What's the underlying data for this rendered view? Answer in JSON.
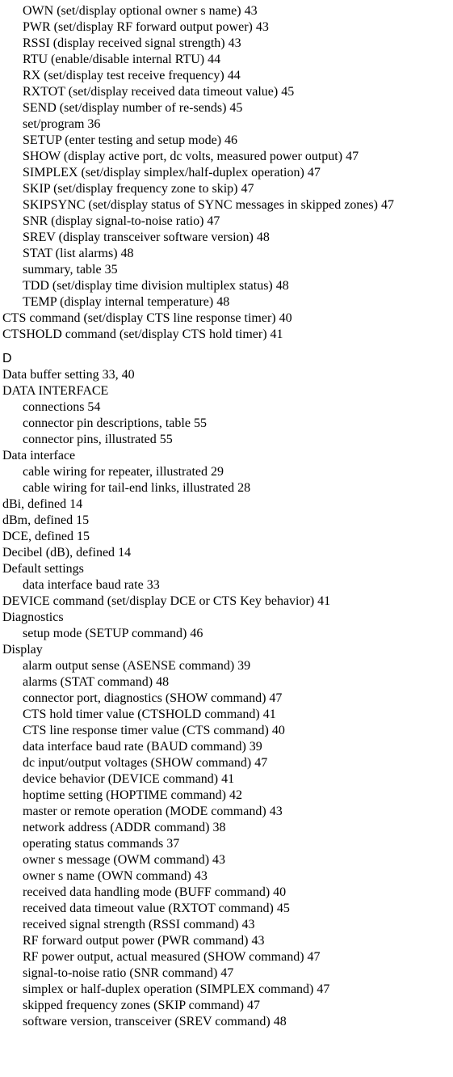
{
  "entries": [
    {
      "level": 1,
      "text": "OWN (set/display optional owner s name)",
      "pages": "43"
    },
    {
      "level": 1,
      "text": "PWR (set/display RF forward output power)",
      "pages": "43"
    },
    {
      "level": 1,
      "text": "RSSI (display received signal strength)",
      "pages": "43"
    },
    {
      "level": 1,
      "text": "RTU (enable/disable internal RTU)",
      "pages": "44"
    },
    {
      "level": 1,
      "text": "RX (set/display test receive frequency)",
      "pages": "44"
    },
    {
      "level": 1,
      "text": "RXTOT (set/display received data timeout value)",
      "pages": "45"
    },
    {
      "level": 1,
      "text": "SEND (set/display number of re-sends)",
      "pages": "45"
    },
    {
      "level": 1,
      "text": "set/program",
      "pages": "36"
    },
    {
      "level": 1,
      "text": "SETUP (enter testing and setup mode)",
      "pages": "46"
    },
    {
      "level": 1,
      "text": "SHOW (display active port, dc volts, measured power output)",
      "pages": "47"
    },
    {
      "level": 1,
      "text": "SIMPLEX (set/display simplex/half-duplex operation)",
      "pages": "47"
    },
    {
      "level": 1,
      "text": "SKIP (set/display frequency zone to skip)",
      "pages": "47"
    },
    {
      "level": 1,
      "text": "SKIPSYNC (set/display status of SYNC messages in skipped zones)",
      "pages": "47"
    },
    {
      "level": 1,
      "text": "SNR (display signal-to-noise ratio)",
      "pages": "47"
    },
    {
      "level": 1,
      "text": "SREV (display transceiver software version)",
      "pages": "48"
    },
    {
      "level": 1,
      "text": "STAT (list alarms)",
      "pages": "48"
    },
    {
      "level": 1,
      "text": "summary, table",
      "pages": "35"
    },
    {
      "level": 1,
      "text": "TDD (set/display time division multiplex status)",
      "pages": "48"
    },
    {
      "level": 1,
      "text": "TEMP (display internal temperature)",
      "pages": "48"
    },
    {
      "level": 0,
      "text": "CTS command (set/display CTS line response timer)",
      "pages": "40"
    },
    {
      "level": 0,
      "text": "CTSHOLD command (set/display CTS hold timer)",
      "pages": "41"
    },
    {
      "section": "D"
    },
    {
      "level": 0,
      "text": "Data buffer setting",
      "pages": "33, 40"
    },
    {
      "level": 0,
      "text": "DATA INTERFACE",
      "pages": ""
    },
    {
      "level": 1,
      "text": "connections",
      "pages": "54"
    },
    {
      "level": 1,
      "text": "connector pin descriptions, table",
      "pages": "55"
    },
    {
      "level": 1,
      "text": "connector pins, illustrated",
      "pages": "55"
    },
    {
      "level": 0,
      "text": "Data interface",
      "pages": ""
    },
    {
      "level": 1,
      "text": "cable wiring for repeater, illustrated",
      "pages": "29"
    },
    {
      "level": 1,
      "text": "cable wiring for tail-end links, illustrated",
      "pages": "28"
    },
    {
      "level": 0,
      "text": "dBi, defined",
      "pages": "14"
    },
    {
      "level": 0,
      "text": "dBm, defined",
      "pages": "15"
    },
    {
      "level": 0,
      "text": "DCE, defined",
      "pages": "15"
    },
    {
      "level": 0,
      "text": "Decibel (dB), defined",
      "pages": "14"
    },
    {
      "level": 0,
      "text": "Default settings",
      "pages": ""
    },
    {
      "level": 1,
      "text": "data interface baud rate",
      "pages": "33"
    },
    {
      "level": 0,
      "text": "DEVICE command (set/display DCE or CTS Key behavior)",
      "pages": "41"
    },
    {
      "level": 0,
      "text": "Diagnostics",
      "pages": ""
    },
    {
      "level": 1,
      "text": "setup mode (SETUP command)",
      "pages": "46"
    },
    {
      "level": 0,
      "text": "Display",
      "pages": ""
    },
    {
      "level": 1,
      "text": "alarm output sense (ASENSE command)",
      "pages": "39"
    },
    {
      "level": 1,
      "text": "alarms (STAT command)",
      "pages": "48"
    },
    {
      "level": 1,
      "text": "connector port, diagnostics (SHOW command)",
      "pages": "47"
    },
    {
      "level": 1,
      "text": "CTS hold timer value (CTSHOLD command)",
      "pages": "41"
    },
    {
      "level": 1,
      "text": "CTS line response timer value (CTS command)",
      "pages": "40"
    },
    {
      "level": 1,
      "text": "data interface baud rate (BAUD command)",
      "pages": "39"
    },
    {
      "level": 1,
      "text": "dc input/output voltages (SHOW command)",
      "pages": "47"
    },
    {
      "level": 1,
      "text": "device behavior (DEVICE command)",
      "pages": "41"
    },
    {
      "level": 1,
      "text": "hoptime setting (HOPTIME command)",
      "pages": "42"
    },
    {
      "level": 1,
      "text": "master or remote operation (MODE command)",
      "pages": "43"
    },
    {
      "level": 1,
      "text": "network address (ADDR command)",
      "pages": "38"
    },
    {
      "level": 1,
      "text": "operating status commands",
      "pages": "37"
    },
    {
      "level": 1,
      "text": "owner s message (OWM command)",
      "pages": "43"
    },
    {
      "level": 1,
      "text": "owner s name (OWN command)",
      "pages": "43"
    },
    {
      "level": 1,
      "text": "received data handling mode (BUFF command)",
      "pages": "40"
    },
    {
      "level": 1,
      "text": "received data timeout value (RXTOT command)",
      "pages": "45"
    },
    {
      "level": 1,
      "text": "received signal strength (RSSI command)",
      "pages": "43"
    },
    {
      "level": 1,
      "text": "RF forward output power (PWR command)",
      "pages": "43"
    },
    {
      "level": 1,
      "text": "RF power output, actual measured (SHOW command)",
      "pages": "47"
    },
    {
      "level": 1,
      "text": "signal-to-noise ratio (SNR command)",
      "pages": "47"
    },
    {
      "level": 1,
      "text": "simplex or half-duplex operation (SIMPLEX command)",
      "pages": "47"
    },
    {
      "level": 1,
      "text": "skipped frequency zones (SKIP command)",
      "pages": "47"
    },
    {
      "level": 1,
      "text": "software version, transceiver (SREV command)",
      "pages": "48"
    }
  ]
}
